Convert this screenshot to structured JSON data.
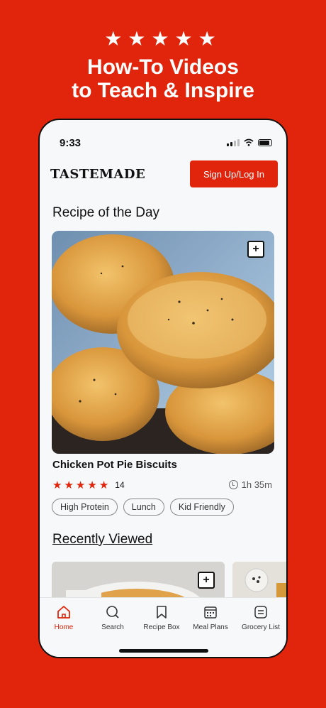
{
  "promo": {
    "stars": "★★★★★",
    "title_line1": "How-To Videos",
    "title_line2": "to Teach & Inspire"
  },
  "status_bar": {
    "time": "9:33"
  },
  "header": {
    "logo": "TASTEMADE",
    "signup_label": "Sign Up/Log In"
  },
  "recipe_of_day": {
    "section_title": "Recipe of the Day",
    "name": "Chicken Pot Pie Biscuits",
    "rating_stars": 5,
    "rating_count": "14",
    "duration": "1h 35m",
    "tags": [
      "High Protein",
      "Lunch",
      "Kid Friendly"
    ]
  },
  "recently_viewed": {
    "section_title": "Recently Viewed"
  },
  "tabs": [
    {
      "label": "Home",
      "icon": "home-icon",
      "active": true
    },
    {
      "label": "Search",
      "icon": "search-icon",
      "active": false
    },
    {
      "label": "Recipe Box",
      "icon": "bookmark-icon",
      "active": false
    },
    {
      "label": "Meal Plans",
      "icon": "calendar-icon",
      "active": false
    },
    {
      "label": "Grocery List",
      "icon": "list-icon",
      "active": false
    }
  ],
  "colors": {
    "brand": "#e0250c",
    "background": "#f7f8fa"
  }
}
